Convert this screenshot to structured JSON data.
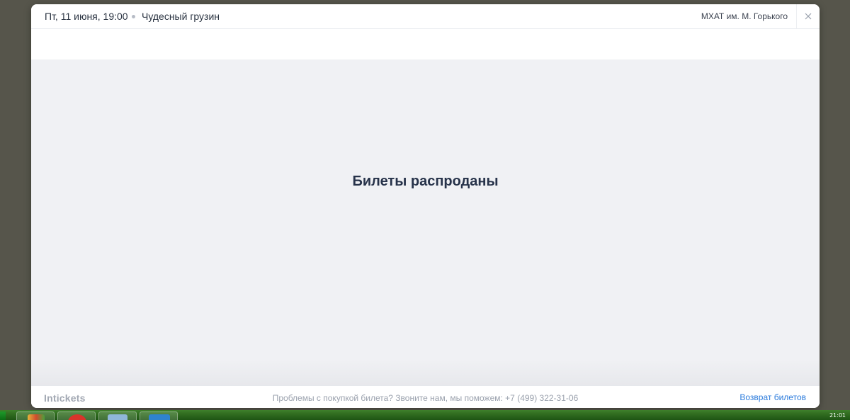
{
  "header": {
    "date": "Пт, 11 июня, 19:00",
    "title": "Чудесный грузин",
    "venue": "МХАТ им. М. Горького"
  },
  "content": {
    "message": "Билеты распроданы"
  },
  "footer": {
    "brand": "Intickets",
    "help": "Проблемы с покупкой билета? Звоните нам, мы поможем: +7 (499) 322-31-06",
    "return_link": "Возврат билетов"
  },
  "taskbar": {
    "clock": "21:01"
  },
  "colors": {
    "accent_link": "#2b7bdc",
    "title_text": "#27334a",
    "content_bg": "#f0f1f4",
    "backdrop": "#56554b",
    "taskbar": "#2f6a1f"
  },
  "icons": {
    "close": "close-icon",
    "separator": "dot-separator-icon"
  }
}
